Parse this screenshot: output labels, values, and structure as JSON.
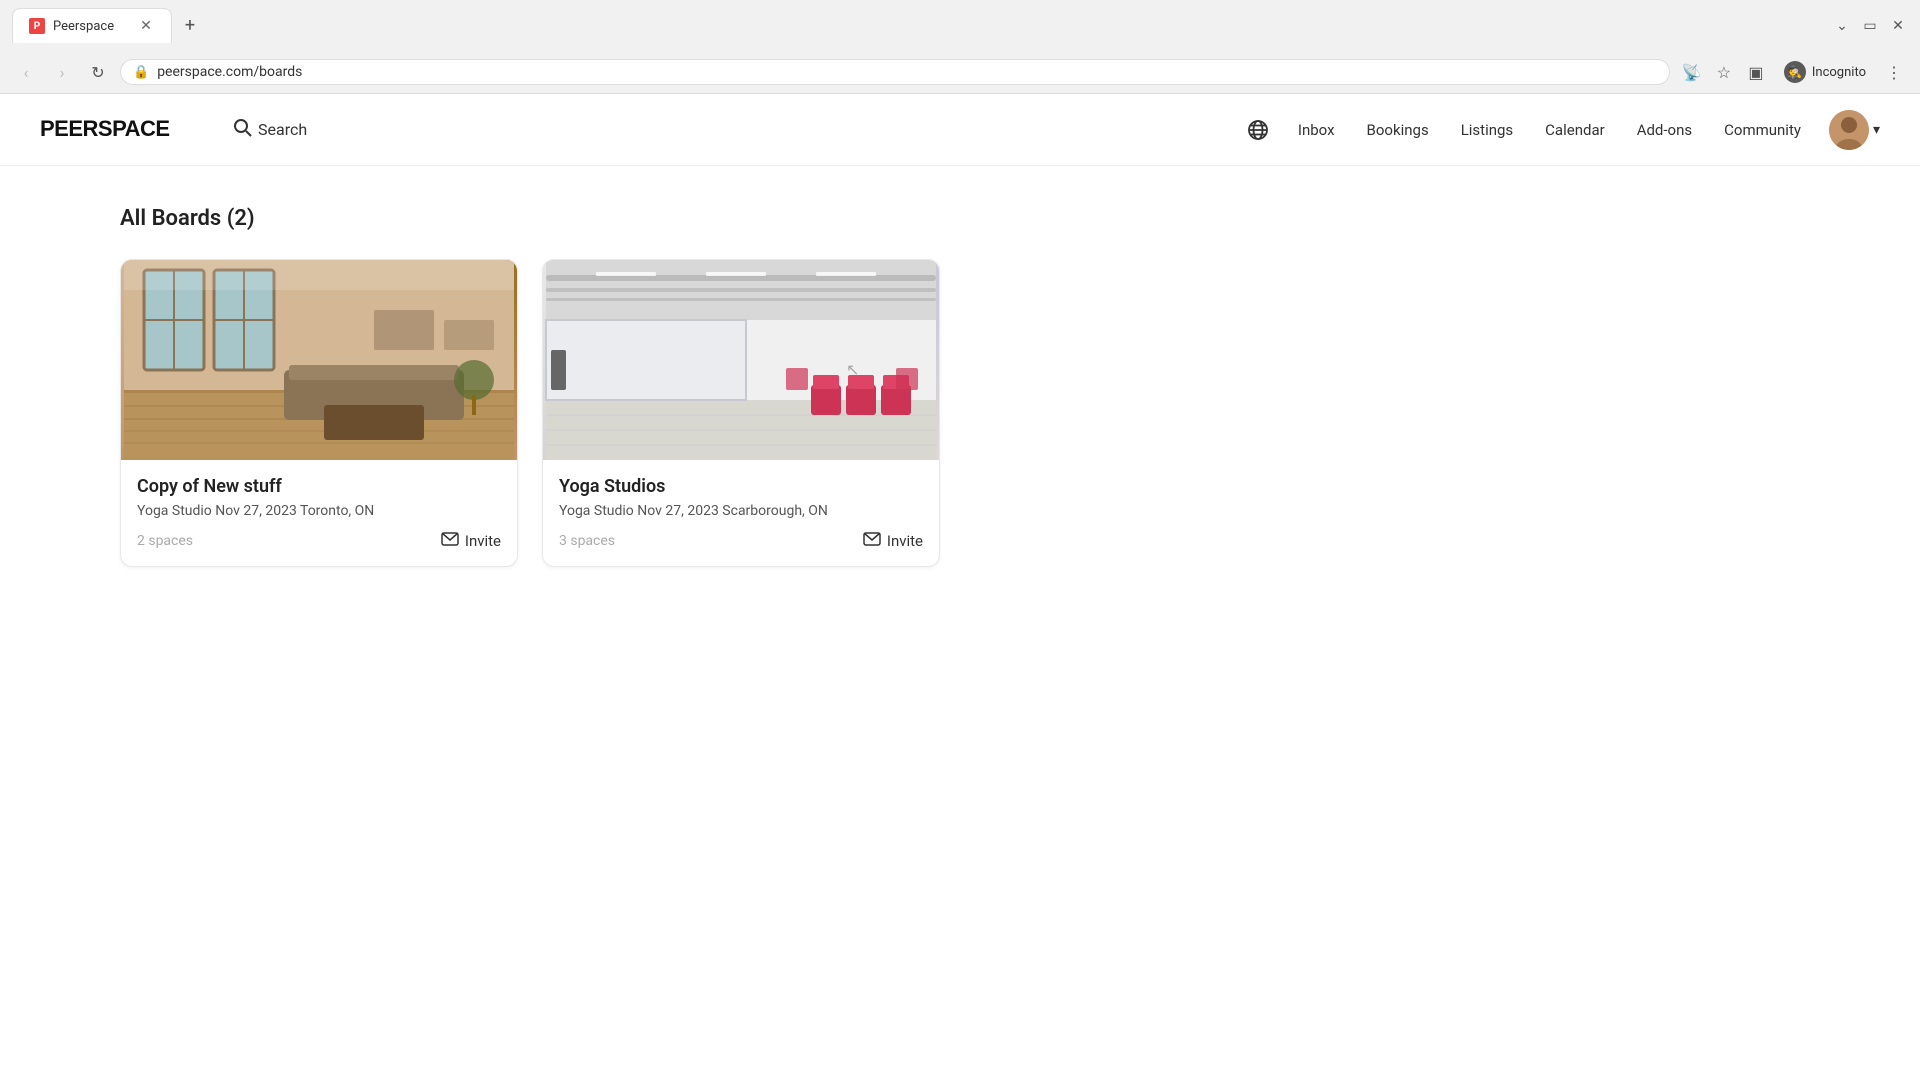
{
  "browser": {
    "tab_label": "Peerspace",
    "tab_favicon": "P",
    "url": "peerspace.com/boards",
    "incognito_label": "Incognito"
  },
  "header": {
    "logo_text": "PEERSPACE",
    "search_label": "Search",
    "nav_links": [
      {
        "id": "inbox",
        "label": "Inbox"
      },
      {
        "id": "bookings",
        "label": "Bookings"
      },
      {
        "id": "listings",
        "label": "Listings"
      },
      {
        "id": "calendar",
        "label": "Calendar"
      },
      {
        "id": "addons",
        "label": "Add-ons"
      },
      {
        "id": "community",
        "label": "Community"
      }
    ]
  },
  "main": {
    "heading": "All Boards (2)",
    "boards": [
      {
        "id": "board1",
        "title": "Copy of New stuff",
        "subtitle": "Yoga Studio Nov 27, 2023 Toronto, ON",
        "spaces_label": "2 spaces",
        "invite_label": "Invite"
      },
      {
        "id": "board2",
        "title": "Yoga Studios",
        "subtitle": "Yoga Studio Nov 27, 2023 Scarborough, ON",
        "spaces_label": "3 spaces",
        "invite_label": "Invite"
      }
    ]
  }
}
